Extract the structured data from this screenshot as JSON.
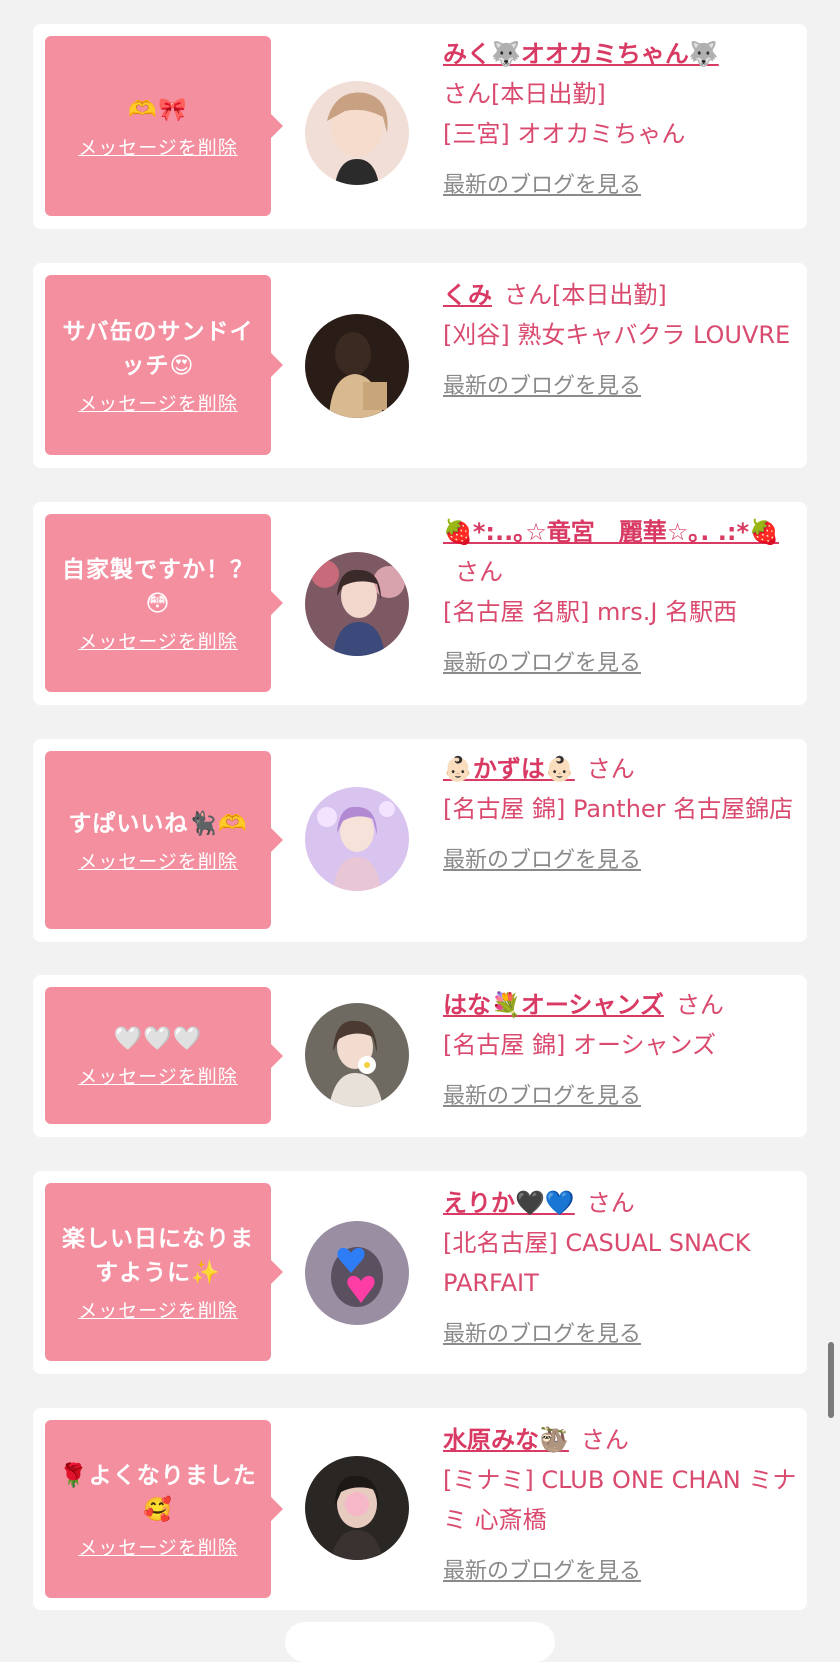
{
  "delete_label": "メッセージを削除",
  "blog_label": "最新のブログを見る",
  "san_label": "さん",
  "entries": [
    {
      "message": "🫶🎀",
      "name": "みく🐺オオカミちゃん🐺",
      "status": "[本日出勤]",
      "shop": "[三宮] オオカミちゃん"
    },
    {
      "message": "サバ缶のサンドイッチ😍",
      "name": "くみ",
      "status": "[本日出勤]",
      "shop": "[刈谷] 熟女キャバクラ LOUVRE"
    },
    {
      "message": "自家製ですか！？😳",
      "name": "🍓*:..｡☆竜宮　麗華☆｡. .:*🍓",
      "status": "",
      "shop": "[名古屋 名駅] mrs.J 名駅西"
    },
    {
      "message": "すぱいいね🐈‍⬛🫶",
      "name": "👶🏻かずは👶🏻",
      "status": "",
      "shop": "[名古屋 錦] Panther 名古屋錦店"
    },
    {
      "message": "🤍🤍🤍",
      "name": "はな💐オーシャンズ",
      "status": "",
      "shop": "[名古屋 錦] オーシャンズ"
    },
    {
      "message": "楽しい日になりますように✨",
      "name": "えりか🖤💙",
      "status": "",
      "shop": "[北名古屋] CASUAL SNACK PARFAIT"
    },
    {
      "message": "🌹よくなりました🥰",
      "name": "水原みな🦥",
      "status": "",
      "shop": "[ミナミ] CLUB ONE CHAN ミナミ 心斎橋"
    }
  ]
}
